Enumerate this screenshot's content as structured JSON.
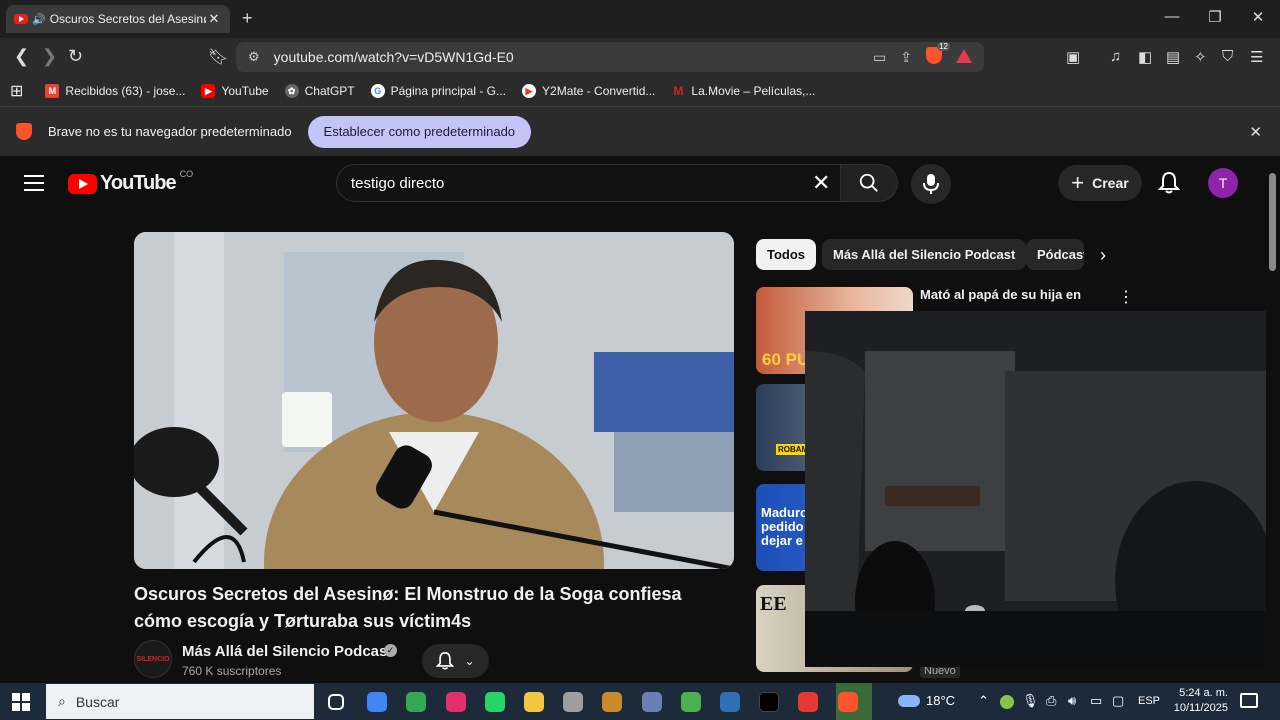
{
  "browser": {
    "tab_title": "Oscuros Secretos del Asesinø",
    "new_tab": "+",
    "url": "youtube.com/watch?v=vD5WN1Gd-E0",
    "shield_badge": "12",
    "window_controls": {
      "minimize": "—",
      "maximize": "❐",
      "close": "✕"
    },
    "bookmarks": [
      {
        "label": "Recibidos (63) - jose...",
        "icon": "gmail-icon",
        "color": "#ea4335"
      },
      {
        "label": "YouTube",
        "icon": "youtube-icon",
        "color": "#ff0000"
      },
      {
        "label": "ChatGPT",
        "icon": "chatgpt-icon",
        "color": "#777777"
      },
      {
        "label": "Página principal - G...",
        "icon": "google-icon",
        "color": "#4285f4"
      },
      {
        "label": "Y2Mate - Convertid...",
        "icon": "y2mate-icon",
        "color": "#e53935"
      },
      {
        "label": "La.Movie – Películas,...",
        "icon": "lamovie-icon",
        "color": "#c62828"
      }
    ],
    "infobar": {
      "message": "Brave no es tu navegador predeterminado",
      "button": "Establecer como predeterminado",
      "close": "✕"
    }
  },
  "youtube": {
    "logo_text": "YouTube",
    "country_code": "CO",
    "search_value": "testigo directo",
    "create_label": "Crear",
    "avatar_letter": "T",
    "video": {
      "title": "Oscuros Secretos del Asesinø: El Monstruo de la Soga confiesa cómo escogía y Tørturaba sus víctim4s",
      "channel": "Más Allá del Silencio Podcast",
      "subscribers": "760 K suscriptores",
      "channel_avatar_text": "SILENCIO"
    },
    "chips": [
      "Todos",
      "Más Allá del Silencio Podcast",
      "Pódcasts"
    ],
    "recommendations": [
      {
        "title": "Mató al papá de su hija en",
        "thumb_text": "60 PU"
      },
      {
        "title": "",
        "thumb_text": "ROBAMOS"
      },
      {
        "title": "",
        "thumb_text": "Maduro pedido dejar e"
      },
      {
        "title": "",
        "thumb_text": "EE"
      }
    ],
    "badge_new": "Nuevo"
  },
  "taskbar": {
    "search_placeholder": "Buscar",
    "weather": "18°C",
    "language": "ESP",
    "time": "5:24 a. m.",
    "date": "10/11/2025",
    "apps": [
      {
        "name": "task-view-icon",
        "color": "#ffffff"
      },
      {
        "name": "chrome-icon",
        "color": "#4285f4"
      },
      {
        "name": "chrome-icon",
        "color": "#34a853"
      },
      {
        "name": "instagram-icon",
        "color": "#e1306c"
      },
      {
        "name": "whatsapp-icon",
        "color": "#25d366"
      },
      {
        "name": "file-explorer-icon",
        "color": "#f4c542"
      },
      {
        "name": "speedometer-icon",
        "color": "#9e9e9e"
      },
      {
        "name": "app-icon",
        "color": "#c88a2a"
      },
      {
        "name": "app-icon",
        "color": "#6b7fb5"
      },
      {
        "name": "sims-plumbob-icon",
        "color": "#4caf50"
      },
      {
        "name": "app-icon",
        "color": "#2e6fb5"
      },
      {
        "name": "tiktok-icon",
        "color": "#000000"
      },
      {
        "name": "app-icon",
        "color": "#e53935"
      },
      {
        "name": "brave-icon",
        "color": "#fb542b"
      }
    ]
  }
}
